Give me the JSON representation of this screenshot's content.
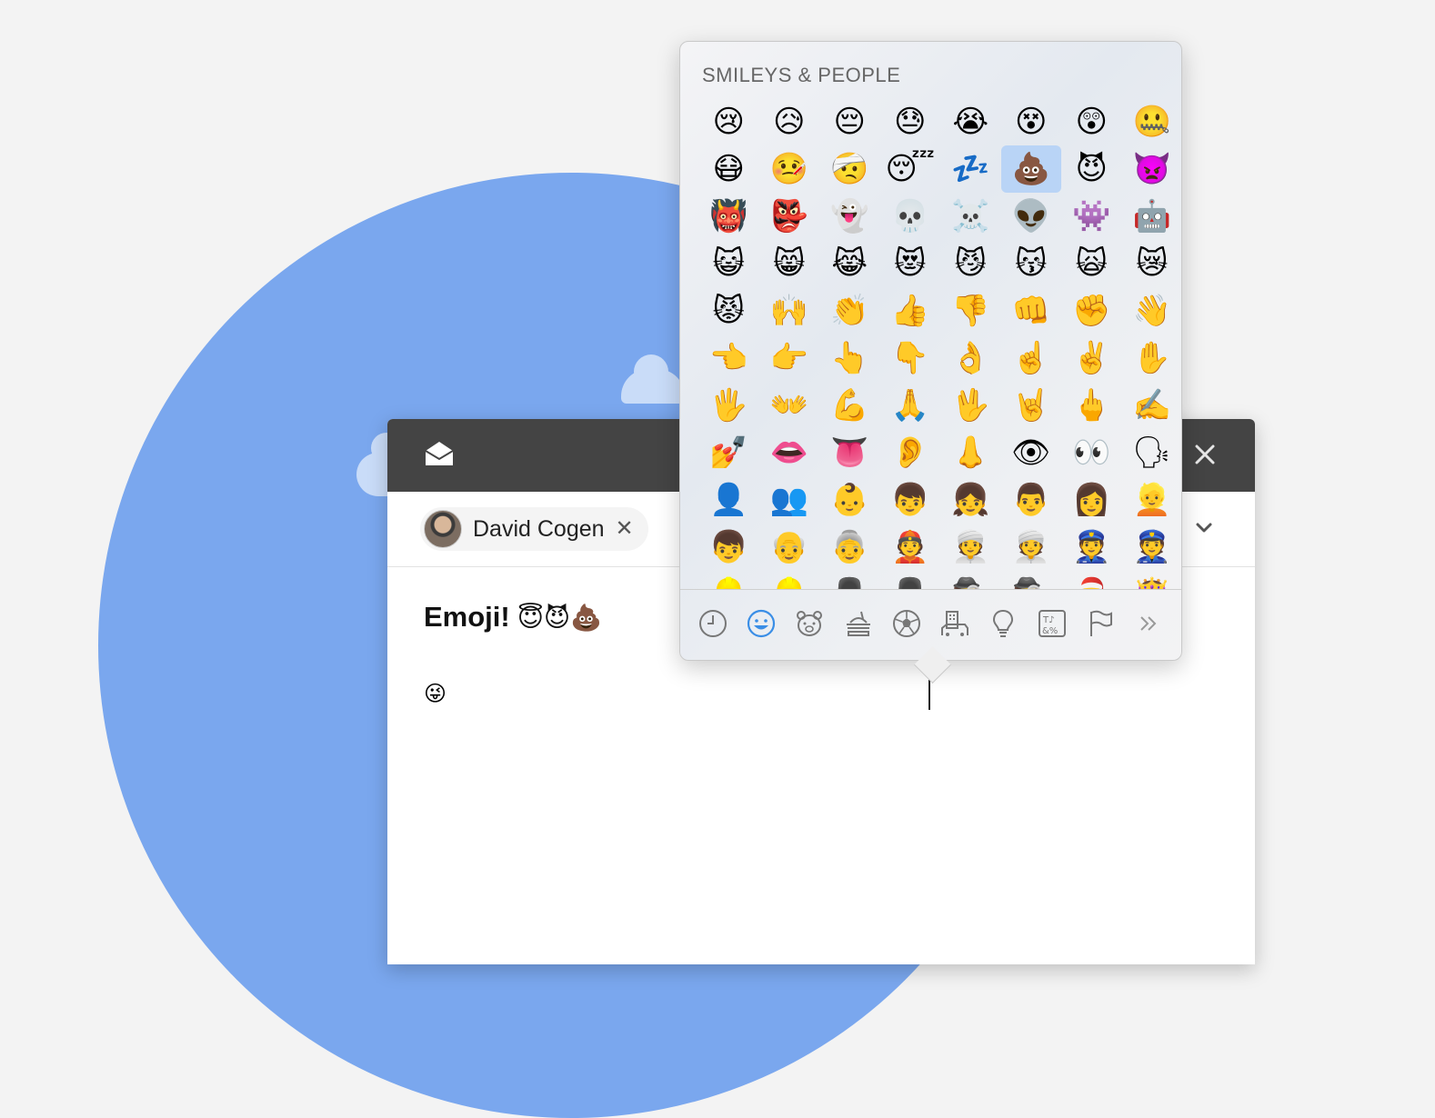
{
  "compose": {
    "recipient_name": "David Cogen",
    "remove_symbol": "✕",
    "subject_text": "Emoji!",
    "subject_emojis": "😇😈💩",
    "body_emoji": "😜"
  },
  "picker": {
    "section_title": "SMILEYS & PEOPLE",
    "emojis": [
      "😢",
      "😥",
      "😔",
      "😓",
      "😭",
      "😵",
      "😲",
      "🤐",
      "😷",
      "🤒",
      "🤕",
      "😴",
      "💤",
      "💩",
      "😈",
      "👿",
      "👹",
      "👺",
      "👻",
      "💀",
      "☠️",
      "👽",
      "👾",
      "🤖",
      "😺",
      "😸",
      "😹",
      "😻",
      "😼",
      "😽",
      "🙀",
      "😿",
      "😾",
      "🙌",
      "👏",
      "👍",
      "👎",
      "👊",
      "✊",
      "👋",
      "👈",
      "👉",
      "👆",
      "👇",
      "👌",
      "☝️",
      "✌️",
      "✋",
      "🖐",
      "👐",
      "💪",
      "🙏",
      "🖖",
      "🤘",
      "🖕",
      "✍️",
      "💅",
      "👄",
      "👅",
      "👂",
      "👃",
      "👁",
      "👀",
      "🗣",
      "👤",
      "👥",
      "👶",
      "👦",
      "👧",
      "👨",
      "👩",
      "👱",
      "👦",
      "👴",
      "👵",
      "👲",
      "👳",
      "👳",
      "👮",
      "👮",
      "👷",
      "👷",
      "💂",
      "💂",
      "🕵",
      "🕵",
      "🎅",
      "👸"
    ],
    "selected_emoji": "💩",
    "categories": [
      "recent-icon",
      "smileys-icon",
      "animals-icon",
      "food-icon",
      "activity-icon",
      "travel-icon",
      "objects-icon",
      "symbols-icon",
      "flags-icon",
      "more-icon"
    ],
    "active_category": "smileys-icon"
  },
  "colors": {
    "background": "#f3f3f3",
    "circle": "#7aa7ee",
    "compose_header": "#444444",
    "accent": "#3a8ee6",
    "selected_cell": "#b9d4f6"
  }
}
